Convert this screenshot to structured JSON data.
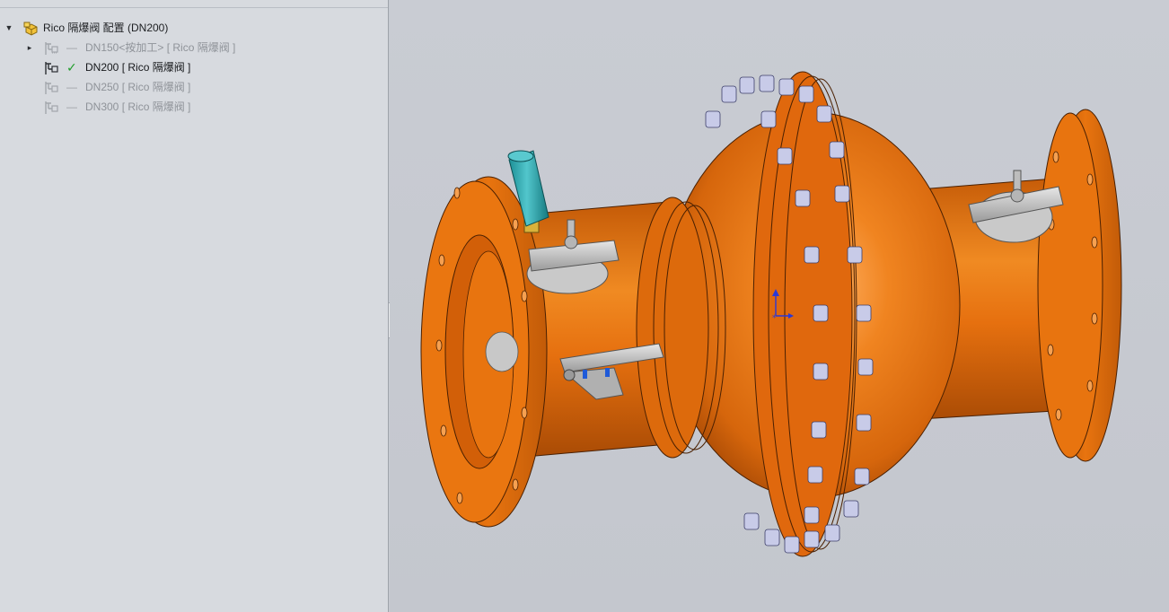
{
  "config_tree": {
    "root": {
      "label": "Rico 隔爆阀 配置  (DN200)",
      "expanded": true
    },
    "items": [
      {
        "label": "DN150<按加工> [ Rico 隔爆阀 ]",
        "status": "inactive",
        "has_children": true
      },
      {
        "label": "DN200 [ Rico 隔爆阀 ]",
        "status": "active",
        "has_children": false
      },
      {
        "label": "DN250 [ Rico 隔爆阀 ]",
        "status": "inactive",
        "has_children": false
      },
      {
        "label": "DN300 [ Rico 隔爆阀 ]",
        "status": "inactive",
        "has_children": false
      }
    ]
  },
  "colors": {
    "body_orange": "#e8700f",
    "active_check": "#1f9d2a",
    "inactive_text": "#8f9399"
  },
  "icons": {
    "root": "assembly-config-icon",
    "config": "configuration-icon",
    "active_marker": "checkmark-icon",
    "axes": "triad-axes-icon"
  }
}
